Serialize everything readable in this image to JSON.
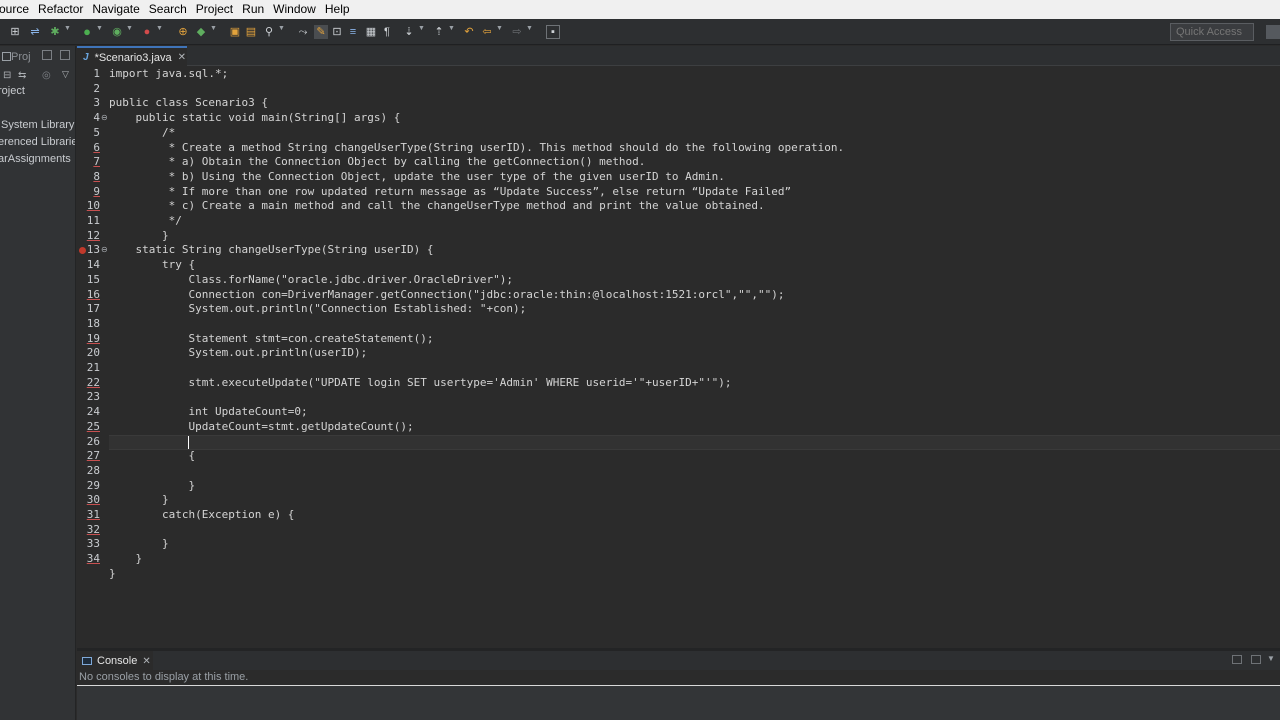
{
  "menubar": {
    "items": [
      {
        "label": "ource",
        "underline_index": -1
      },
      {
        "label": "Refactor",
        "underline_index": 2
      },
      {
        "label": "Navigate",
        "underline_index": 0
      },
      {
        "label": "Search",
        "underline_index": 1
      },
      {
        "label": "Project",
        "underline_index": 0
      },
      {
        "label": "Run",
        "underline_index": 0
      },
      {
        "label": "Window",
        "underline_index": 0
      },
      {
        "label": "Help",
        "underline_index": 0
      }
    ]
  },
  "toolbar": {
    "quick_access_placeholder": "Quick Access"
  },
  "left_panel": {
    "tab_label": "Proj",
    "tree_items": [
      "roject",
      "System Library",
      "erenced Librarie",
      "arAssignments"
    ]
  },
  "editor": {
    "tab_label": "*Scenario3.java",
    "line_numbers": [
      "1",
      "2",
      "3",
      "4",
      "5",
      "6",
      "7",
      "8",
      "9",
      "10",
      "11",
      "12",
      "13",
      "14",
      "15",
      "16",
      "17",
      "18",
      "19",
      "20",
      "21",
      "22",
      "23",
      "24",
      "25",
      "26",
      "27",
      "28",
      "29",
      "30",
      "31",
      "32",
      "33",
      "34"
    ],
    "lines": [
      "import java.sql.*;",
      "",
      "public class Scenario3 {",
      "    public static void main(String[] args) {",
      "        /*",
      "         * Create a method String changeUserType(String userID). This method should do the following operation.",
      "         * a) Obtain the Connection Object by calling the getConnection() method.",
      "         * b) Using the Connection Object, update the user type of the given userID to Admin.",
      "         * If more than one row updated return message as “Update Success”, else return “Update Failed”",
      "         * c) Create a main method and call the changeUserType method and print the value obtained.",
      "         */",
      "        }",
      "    static String changeUserType(String userID) {",
      "        try {",
      "            Class.forName(\"oracle.jdbc.driver.OracleDriver\");",
      "            Connection con=DriverManager.getConnection(\"jdbc:oracle:thin:@localhost:1521:orcl\",\"\",\"\");",
      "            System.out.println(\"Connection Established: \"+con);",
      "",
      "            Statement stmt=con.createStatement();",
      "            System.out.println(userID);",
      "",
      "            stmt.executeUpdate(\"UPDATE login SET usertype='Admin' WHERE userid='\"+userID+\"'\");",
      "",
      "            int UpdateCount=0;",
      "            UpdateCount=stmt.getUpdateCount();",
      "            ",
      "            {",
      "",
      "            }",
      "        }",
      "        catch(Exception e) {",
      "",
      "        }",
      "    }",
      "}"
    ]
  },
  "console": {
    "tab_label": "Console",
    "message": "No consoles to display at this time."
  },
  "colors": {
    "menubar_bg": "#f0f0f0",
    "editor_bg": "#2b2b2b",
    "panel_bg": "#313335",
    "accent_tab": "#3f74b9",
    "type_color": "#e06c4a",
    "field_color": "#a8a6ff"
  },
  "icons": [
    "save-icon",
    "debug-icon",
    "run-icon",
    "coverage-icon",
    "new-java-package-icon",
    "new-java-class-icon",
    "open-type-icon",
    "search-icon",
    "next-annotation-icon",
    "prev-annotation-icon",
    "back-icon",
    "forward-icon",
    "pin-editor-icon",
    "breakpoint-error-icon"
  ]
}
